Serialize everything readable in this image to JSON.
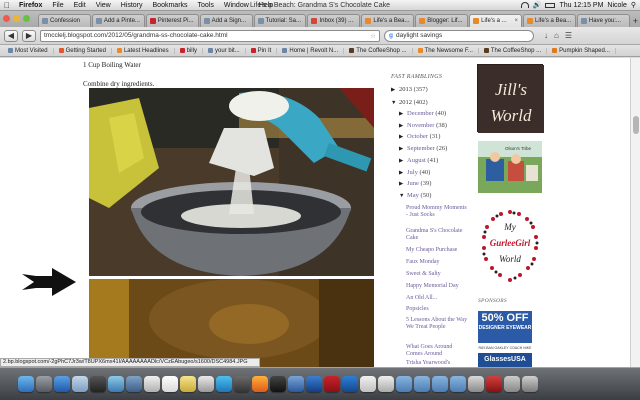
{
  "menubar": {
    "app": "Firefox",
    "items": [
      "File",
      "Edit",
      "View",
      "History",
      "Bookmarks",
      "Tools",
      "Window",
      "Help"
    ],
    "window_title": "Life's a Beach: Grandma S's Chocolate Cake",
    "clock": "Thu 12:15 PM",
    "user": "Nicole"
  },
  "tabs": [
    {
      "label": "Confession",
      "active": false
    },
    {
      "label": "Add a Pinte...",
      "active": false
    },
    {
      "label": "Pinterest Pi...",
      "active": false
    },
    {
      "label": "Add a Sign...",
      "active": false
    },
    {
      "label": "Tutorial: Sa...",
      "active": false
    },
    {
      "label": "Inbox (39) ...",
      "active": false
    },
    {
      "label": "Life's a Bea...",
      "active": false
    },
    {
      "label": "Blogger: Lif...",
      "active": false
    },
    {
      "label": "Life's a ...",
      "active": true
    },
    {
      "label": "Life's a Bea...",
      "active": false
    },
    {
      "label": "Have you:...",
      "active": false
    }
  ],
  "navbar": {
    "url": "tmcclelj.blogspot.com/2012/05/grandma-ss-chocolate-cake.html",
    "search": "daylight savings"
  },
  "bookmarks": [
    "Most Visited",
    "Getting Started",
    "Latest Headlines",
    "billy",
    "your bit...",
    "Pin It",
    "Home | Revolt N...",
    "The CoffeeShop ...",
    "The Newsome F...",
    "The CoffeeShop ...",
    "Pumpkin Shaped..."
  ],
  "post": {
    "line1": "1 Cup Boiling Water",
    "line2": "Combine dry ingredients."
  },
  "sidebar": {
    "heading": "FAST RAMBLINGS",
    "years": [
      {
        "label": "2013",
        "count": "(357)",
        "expanded": false
      },
      {
        "label": "2012",
        "count": "(402)",
        "expanded": true
      }
    ],
    "months": [
      {
        "label": "December",
        "count": "(40)",
        "expanded": false
      },
      {
        "label": "November",
        "count": "(38)",
        "expanded": false
      },
      {
        "label": "October",
        "count": "(31)",
        "expanded": false
      },
      {
        "label": "September",
        "count": "(26)",
        "expanded": false
      },
      {
        "label": "August",
        "count": "(41)",
        "expanded": false
      },
      {
        "label": "July",
        "count": "(40)",
        "expanded": false
      },
      {
        "label": "June",
        "count": "(39)",
        "expanded": false
      },
      {
        "label": "May",
        "count": "(50)",
        "expanded": true
      }
    ],
    "posts": [
      "Proud Mommy Moments - Just Socks",
      "Grandma S's Chocolate Cake",
      "My Cheapo Purchase",
      "Faux Monday",
      "Sweet & Salty",
      "Happy Memorial Day",
      "An Old All...",
      "Popsicles",
      "5 Lessons About the Way We Treat People",
      "What Goes Around Comes Around",
      "Trisha Yearwood's"
    ]
  },
  "rightcol": {
    "jills_world": [
      "Jill's",
      "World"
    ],
    "kids_caption": "Olson's Tribe",
    "gurlee_text": [
      "My",
      "GurleeGirl",
      "World"
    ],
    "sponsors_heading": "SPONSORS",
    "ad_big": "50% OFF",
    "ad_small": "DESIGNER EYEWEAR",
    "ad_brands": [
      "RAY-BAN",
      "OAKLEY",
      "COACH",
      "NIKE"
    ],
    "ad_site": "GlassesUSA"
  },
  "statusbar": "2.bp.blogspot.com/-2gPhC7Jr3w/T8UPX6mx41I/AAAAAAAADlc/VCzEAbugeo/s1600/DSC4984.JPG",
  "colors": {
    "link": "#6b5a9a",
    "ad_blue": "#2b5aa6"
  }
}
